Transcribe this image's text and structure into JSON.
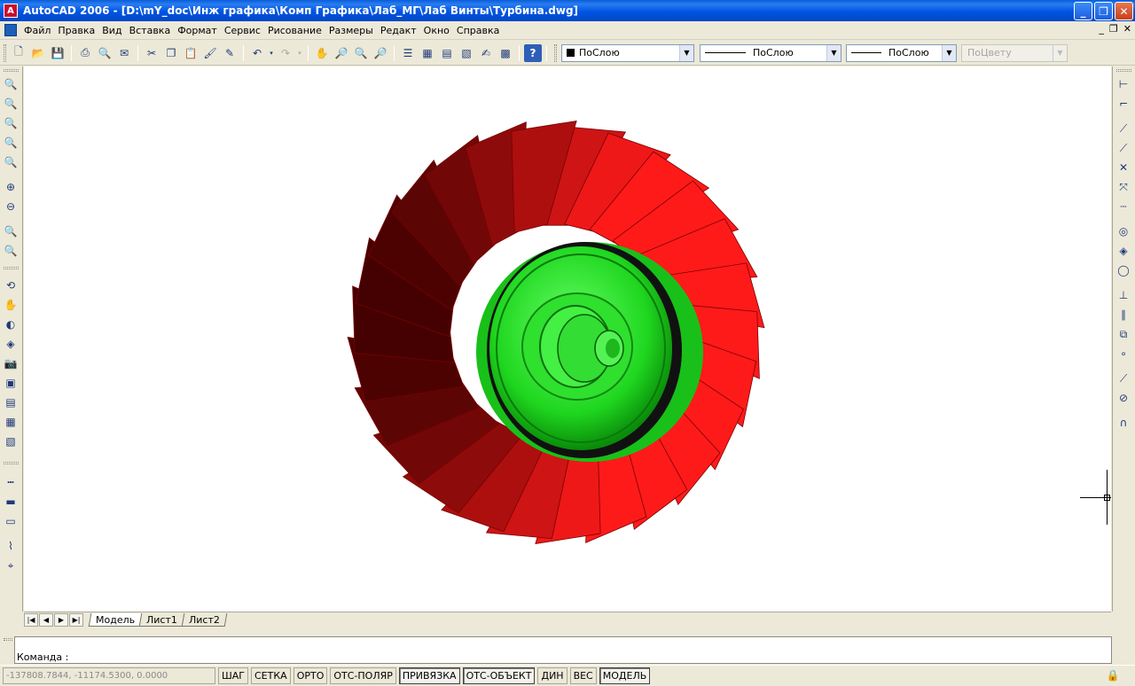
{
  "window": {
    "title": "AutoCAD 2006 - [D:\\mY_doc\\Инж графика\\Комп Графика\\Лаб_МГ\\Лаб Винты\\Турбина.dwg]",
    "app_icon_label": "A",
    "minimize_glyph": "_",
    "maximize_glyph": "❐",
    "close_glyph": "✕"
  },
  "menu": {
    "items": [
      "Файл",
      "Правка",
      "Вид",
      "Вставка",
      "Формат",
      "Сервис",
      "Рисование",
      "Размеры",
      "Редакт",
      "Окно",
      "Справка"
    ],
    "doc_min_glyph": "_",
    "doc_restore_glyph": "❐",
    "doc_close_glyph": "✕"
  },
  "toolbar": {
    "layer_color": "ПоСлою",
    "linetype": "ПоСлою",
    "lineweight": "ПоСлою",
    "plotstyle": "ПоЦвету",
    "arrow_glyph": "▼"
  },
  "tabs": {
    "nav_first": "|◀",
    "nav_prev": "◀",
    "nav_next": "▶",
    "nav_last": "▶|",
    "items": [
      "Модель",
      "Лист1",
      "Лист2"
    ],
    "active": "Модель"
  },
  "command": {
    "prompt": "Команда :"
  },
  "status": {
    "coords": "-137808.7844, -11174.5300, 0.0000",
    "buttons": [
      "ШАГ",
      "СЕТКА",
      "ОРТО",
      "ОТС-ПОЛЯР",
      "ПРИВЯЗКА",
      "ОТС-ОБЪЕКТ",
      "ДИН",
      "ВЕС",
      "МОДЕЛЬ"
    ],
    "on_buttons": [
      "ПРИВЯЗКА",
      "ОТС-ОБЪЕКТ",
      "МОДЕЛЬ"
    ]
  },
  "colors": {
    "blade_red": "#ff1a1a",
    "blade_dark": "#3a0000",
    "hub_green": "#22e022",
    "title_blue": "#0055e3"
  },
  "icons": {
    "left_toolbar": [
      "zoom-realtime-icon",
      "zoom-window-icon",
      "zoom-extents-icon",
      "zoom-all-icon",
      "zoom-previous-icon",
      "zoom-in-icon",
      "zoom-out-icon",
      "zoom-scale-icon",
      "zoom-center-icon",
      "orbit-icon",
      "pan-icon",
      "shade-icon",
      "3d-view-icon",
      "camera-icon",
      "solid-icon",
      "render-icon",
      "material-icon",
      "dimension-linear-icon",
      "dimension-aligned-icon",
      "dimension-baseline-icon",
      "leader-icon",
      "tolerance-icon"
    ],
    "right_toolbar": [
      "osnap-endpoint-icon",
      "osnap-midpoint-icon",
      "osnap-intersection-icon",
      "osnap-apparent-icon",
      "osnap-extension-icon",
      "osnap-center-icon",
      "osnap-quadrant-icon",
      "osnap-tangent-icon",
      "osnap-perpendicular-icon",
      "osnap-parallel-icon",
      "osnap-insert-icon",
      "osnap-node-icon",
      "osnap-nearest-icon",
      "osnap-none-icon",
      "osnap-settings-icon"
    ]
  }
}
